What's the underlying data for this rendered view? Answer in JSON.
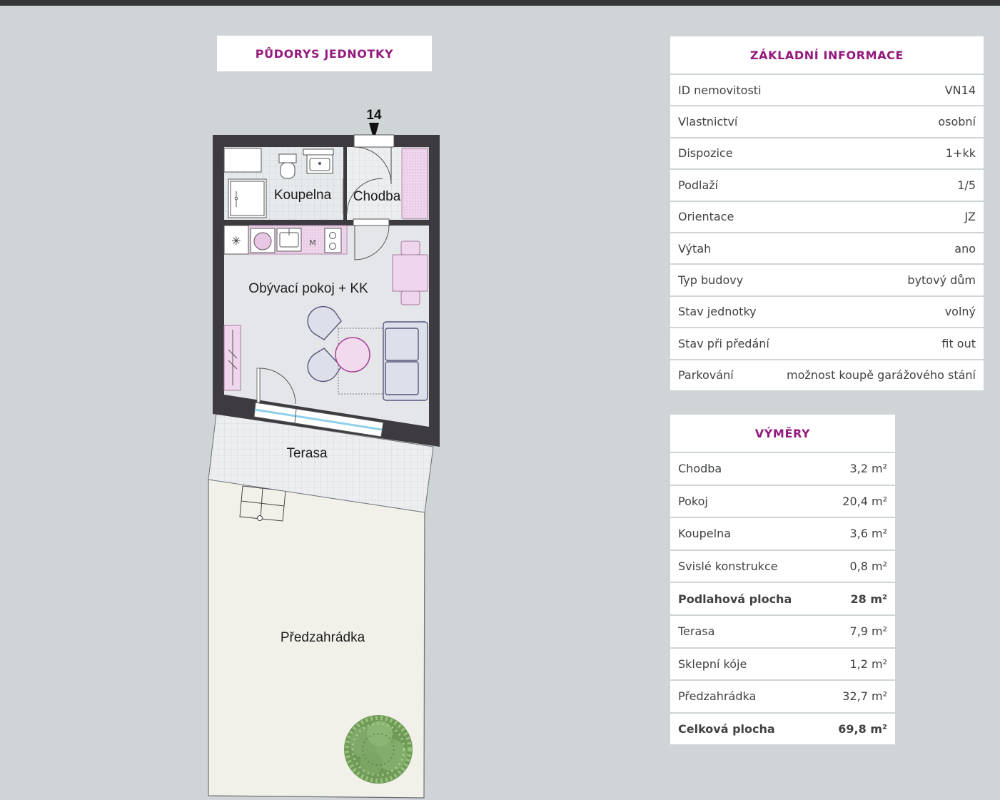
{
  "plan": {
    "title": "PŮDORYS JEDNOTKY",
    "unit_marker": "14",
    "rooms": {
      "bathroom": "Koupelna",
      "hall": "Chodba",
      "living": "Obývací pokoj + KK",
      "terrace": "Terasa",
      "garden": "Předzahrádka"
    },
    "appliance_m": "M"
  },
  "info": {
    "title": "ZÁKLADNÍ INFORMACE",
    "rows": [
      {
        "label": "ID nemovitosti",
        "value": "VN14"
      },
      {
        "label": "Vlastnictví",
        "value": "osobní"
      },
      {
        "label": "Dispozice",
        "value": "1+kk"
      },
      {
        "label": "Podlaží",
        "value": "1/5"
      },
      {
        "label": "Orientace",
        "value": "JZ"
      },
      {
        "label": "Výtah",
        "value": "ano"
      },
      {
        "label": "Typ budovy",
        "value": "bytový dům"
      },
      {
        "label": "Stav jednotky",
        "value": "volný"
      },
      {
        "label": "Stav při předání",
        "value": "fit out"
      },
      {
        "label": "Parkování",
        "value": "možnost koupě garážového stání"
      }
    ]
  },
  "areas": {
    "title": "VÝMĚRY",
    "rows": [
      {
        "label": "Chodba",
        "value": "3,2 m²"
      },
      {
        "label": "Pokoj",
        "value": "20,4 m²"
      },
      {
        "label": "Koupelna",
        "value": "3,6 m²"
      },
      {
        "label": "Svislé konstrukce",
        "value": "0,8 m²"
      },
      {
        "label": "Podlahová plocha",
        "value": "28 m²",
        "bold": true
      },
      {
        "label": "Terasa",
        "value": "7,9 m²"
      },
      {
        "label": "Sklepní kóje",
        "value": "1,2 m²"
      },
      {
        "label": "Předzahrádka",
        "value": "32,7 m²"
      },
      {
        "label": "Celková plocha",
        "value": "69,8 m²",
        "bold": true
      }
    ]
  }
}
